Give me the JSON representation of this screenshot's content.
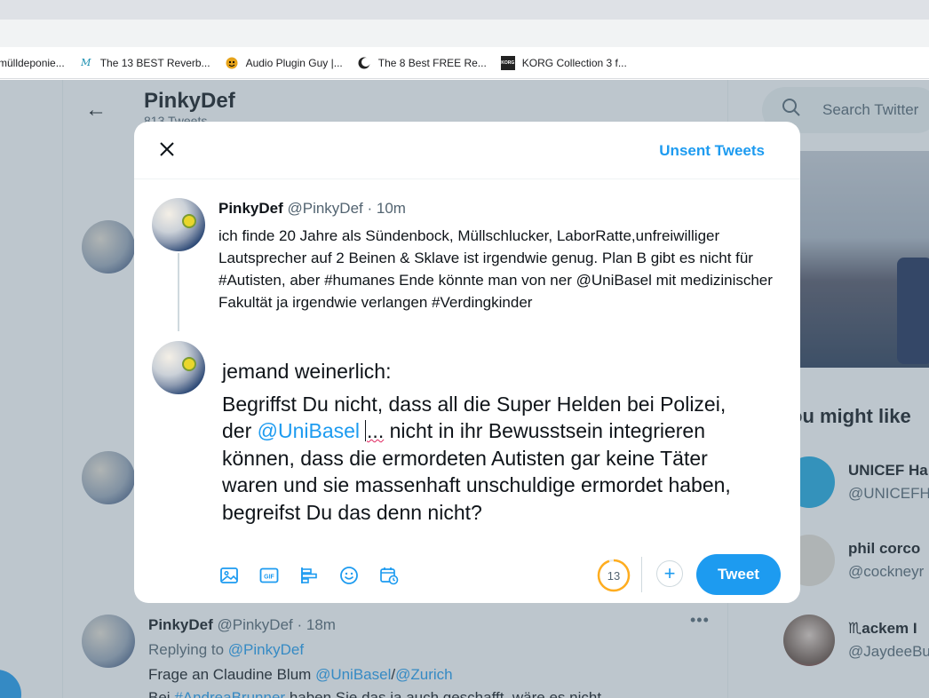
{
  "bookmarks": [
    {
      "label": "rmülldeponie...",
      "icon": "page-icon"
    },
    {
      "label": "The 13 BEST Reverb...",
      "icon": "m-logo-icon"
    },
    {
      "label": "Audio Plugin Guy |...",
      "icon": "face-icon"
    },
    {
      "label": "The 8 Best FREE Re...",
      "icon": "moon-icon"
    },
    {
      "label": "KORG Collection 3 f...",
      "icon": "korg-icon"
    }
  ],
  "background": {
    "profile_name": "PinkyDef",
    "tweet_count": "813 Tweets",
    "search_placeholder": "Search Twitter",
    "who_to_follow_title": "ou might like",
    "suggestions": [
      {
        "name": "UNICEF Ha",
        "handle": "@UNICEFH"
      },
      {
        "name": "phil corco",
        "handle": "@cockneyr"
      },
      {
        "name": "♏ackem I",
        "handle": "@JaydeeBu"
      }
    ],
    "below_tweet": {
      "name": "PinkyDef",
      "handle": "@PinkyDef",
      "time": "· 18m",
      "replying_to_label": "Replying to",
      "replying_to": "@PinkyDef",
      "text_prefix": "Frage an Claudine Blum",
      "mention1": "@UniBasel",
      "slash": "/",
      "mention2": "@Zurich",
      "line2_prefix": "Bei",
      "line2_tag": "#AndreaBrunner",
      "line2_rest": "haben Sie das ja auch geschafft, wäre es nicht"
    }
  },
  "modal": {
    "unsent_label": "Unsent Tweets",
    "original": {
      "name": "PinkyDef",
      "handle": "@PinkyDef",
      "time": "· 10m",
      "text": "ich finde 20 Jahre als Sündenbock, Müllschlucker, LaborRatte,unfreiwilliger Lautsprecher auf 2 Beinen & Sklave ist irgendwie genug. Plan B gibt es nicht für #Autisten, aber #humanes Ende könnte man von ner @UniBasel mit medizinischer Fakultät ja irgendwie verlangen #Verdingkinder"
    },
    "reply": {
      "line1": "jemand weinerlich:",
      "line2": "Begriffst Du nicht, dass all die Super Helden bei Polizei,",
      "line3_prefix": "der",
      "line3_mention": "@UniBasel",
      "line3_squig": "...",
      "line3_rest": "nicht in ihr Bewusstsein integrieren",
      "line4": "können, dass die ermordeten Autisten gar keine Täter",
      "line5": "waren und sie massenhaft unschuldige ermordet haben,",
      "line6": "begreifst Du das denn nicht?"
    },
    "chars_remaining": "13",
    "char_progress": 0.95,
    "tweet_button": "Tweet",
    "colors": {
      "accent": "#1d9bf0",
      "counter_ring": "#ffad1f"
    },
    "toolbar_icons": [
      "image-icon",
      "gif-icon",
      "poll-icon",
      "emoji-icon",
      "schedule-icon"
    ]
  }
}
